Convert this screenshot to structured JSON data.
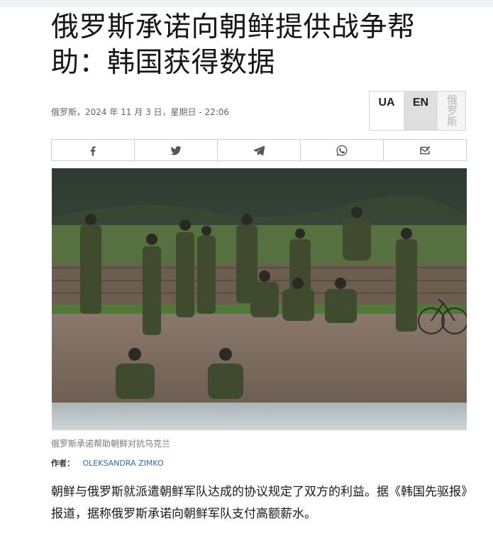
{
  "article": {
    "headline": "俄罗斯承诺向朝鲜提供战争帮助：韩国获得数据",
    "meta": "俄罗斯，2024 年 11 月 3 日，星期日 - 22:06",
    "photo_caption": "俄罗斯承诺帮助朝鲜对抗乌克兰",
    "author_label": "作者：",
    "author_name": "OLEKSANDRA ZIMKO",
    "body": "朝鲜与俄罗斯就派遣朝鲜军队达成的协议规定了双方的利益。据《韩国先驱报》报道，据称俄罗斯承诺向朝鲜军队支付高额薪水。"
  },
  "languages": {
    "ua": "UA",
    "en": "EN",
    "ru": "俄罗斯",
    "active": "EN"
  },
  "share": [
    {
      "icon": "facebook-icon"
    },
    {
      "icon": "twitter-icon"
    },
    {
      "icon": "telegram-icon"
    },
    {
      "icon": "whatsapp-icon"
    },
    {
      "icon": "email-icon"
    }
  ],
  "colors": {
    "author_link": "#2f6bb5",
    "active_lang_bg": "#dedede"
  }
}
